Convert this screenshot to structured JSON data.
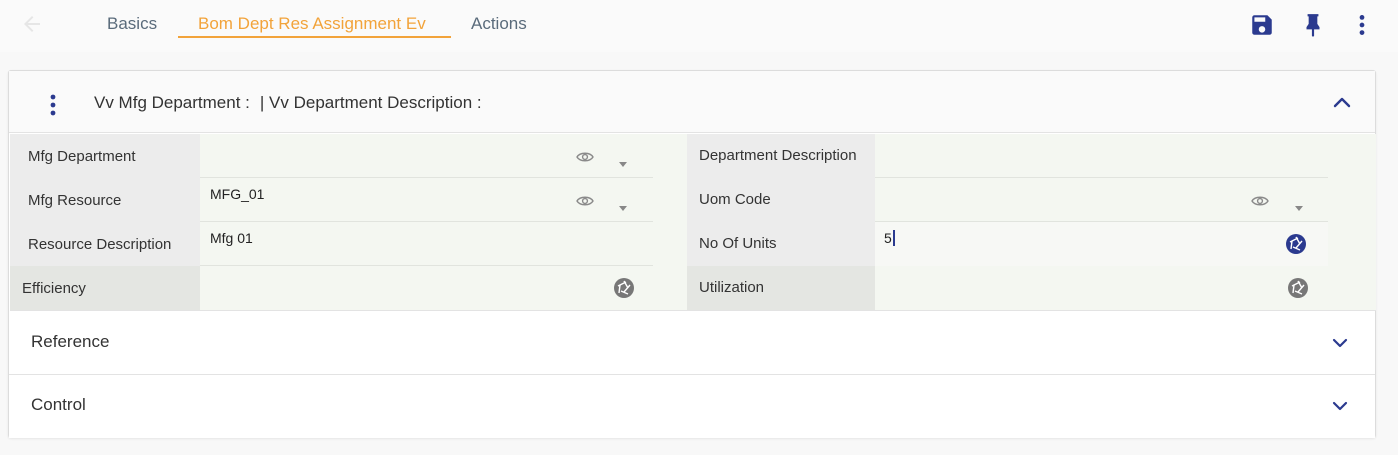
{
  "topbar": {
    "tabs": [
      {
        "label": "Basics"
      },
      {
        "label": "Bom Dept Res Assignment Ev"
      },
      {
        "label": "Actions"
      }
    ],
    "icons": [
      "back-arrow-icon",
      "save-icon",
      "pin-icon",
      "more-vert-icon"
    ]
  },
  "header": {
    "title_left": "Vv Mfg Department  :",
    "title_right": "| Vv Department Description  :"
  },
  "form": {
    "left": [
      {
        "label": "Mfg Department",
        "value": ""
      },
      {
        "label": "Mfg Resource",
        "value": "MFG_01"
      },
      {
        "label": "Resource Description",
        "value": "Mfg 01"
      },
      {
        "label": "Efficiency",
        "value": ""
      }
    ],
    "right": [
      {
        "label": "Department Description",
        "value": ""
      },
      {
        "label": "Uom Code",
        "value": ""
      },
      {
        "label": "No Of Units",
        "value": "5"
      },
      {
        "label": "Utilization",
        "value": ""
      }
    ]
  },
  "sections": [
    {
      "label": "Reference"
    },
    {
      "label": "Control"
    }
  ],
  "colors": {
    "accent": "#f2a33a",
    "primary": "#2b3a8f",
    "tab_text": "#5a6b7b"
  }
}
